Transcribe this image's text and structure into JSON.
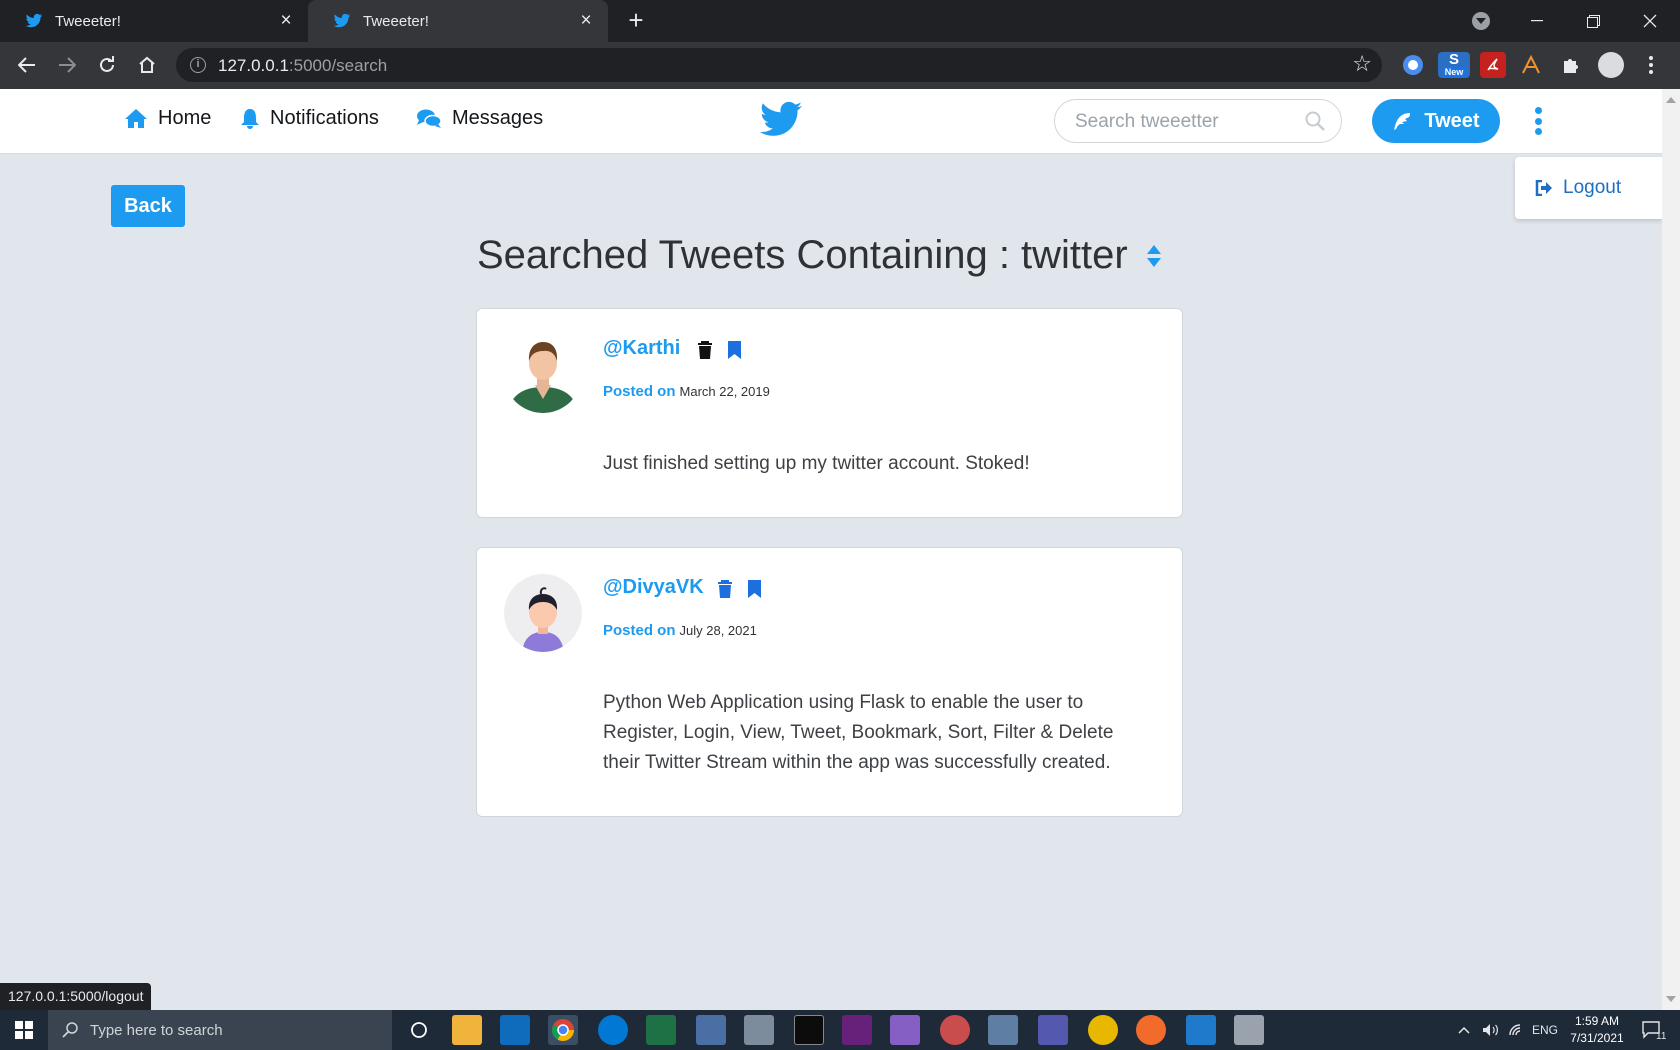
{
  "browser": {
    "tabs": [
      {
        "title": "Tweeeter!",
        "active": false
      },
      {
        "title": "Tweeeter!",
        "active": true
      }
    ],
    "url_host": "127.0.0.1",
    "url_rest": ":5000/search",
    "extension_badge": "New",
    "status_url": "127.0.0.1:5000/logout"
  },
  "nav": {
    "home": "Home",
    "notifications": "Notifications",
    "messages": "Messages",
    "search_placeholder": "Search tweeetter",
    "tweet_button": "Tweet",
    "logout": "Logout"
  },
  "page": {
    "back_button": "Back",
    "heading": "Searched Tweets Containing : twitter"
  },
  "tweets": [
    {
      "handle": "@Karthi",
      "posted_label": "Posted on",
      "date": "March 22, 2019",
      "text": "Just finished setting up my twitter account. Stoked!"
    },
    {
      "handle": "@DivyaVK",
      "posted_label": "Posted on",
      "date": "July 28, 2021",
      "text": "Python Web Application using Flask to enable the user to Register, Login, View, Tweet, Bookmark, Sort, Filter & Delete their Twitter Stream within the app was successfully created."
    }
  ],
  "taskbar": {
    "search_placeholder": "Type here to search",
    "language": "ENG",
    "time": "1:59 AM",
    "date": "7/31/2021",
    "notification_count": "11"
  },
  "colors": {
    "brand": "#1d9bf0",
    "page_bg": "#e1e6ec"
  }
}
